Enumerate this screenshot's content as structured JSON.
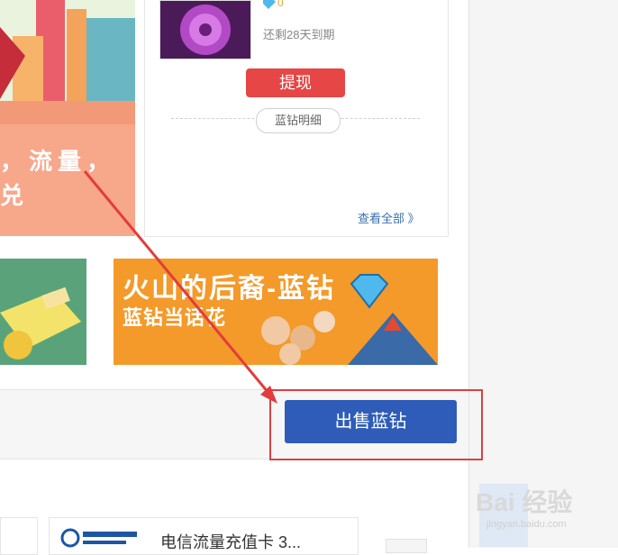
{
  "promo": {
    "overlay_text": "，流量，\n兑"
  },
  "account": {
    "days_left": "还剩28天到期",
    "withdraw_label": "提现",
    "detail_label": "蓝钻明细",
    "view_all_label": "查看全部 》"
  },
  "banner": {
    "title": "火山的后裔-蓝钻",
    "subtitle": "蓝钻当话花"
  },
  "actions": {
    "sell_label": "出售蓝钻"
  },
  "product": {
    "title": "电信流量充值卡 3..."
  },
  "watermark": {
    "brand": "Bai 经验",
    "url": "jingyan.baidu.com"
  },
  "colors": {
    "withdraw_red": "#e64646",
    "sell_blue": "#2e5cb8",
    "highlight_red": "#d94141",
    "banner_orange": "#f39a2a"
  }
}
